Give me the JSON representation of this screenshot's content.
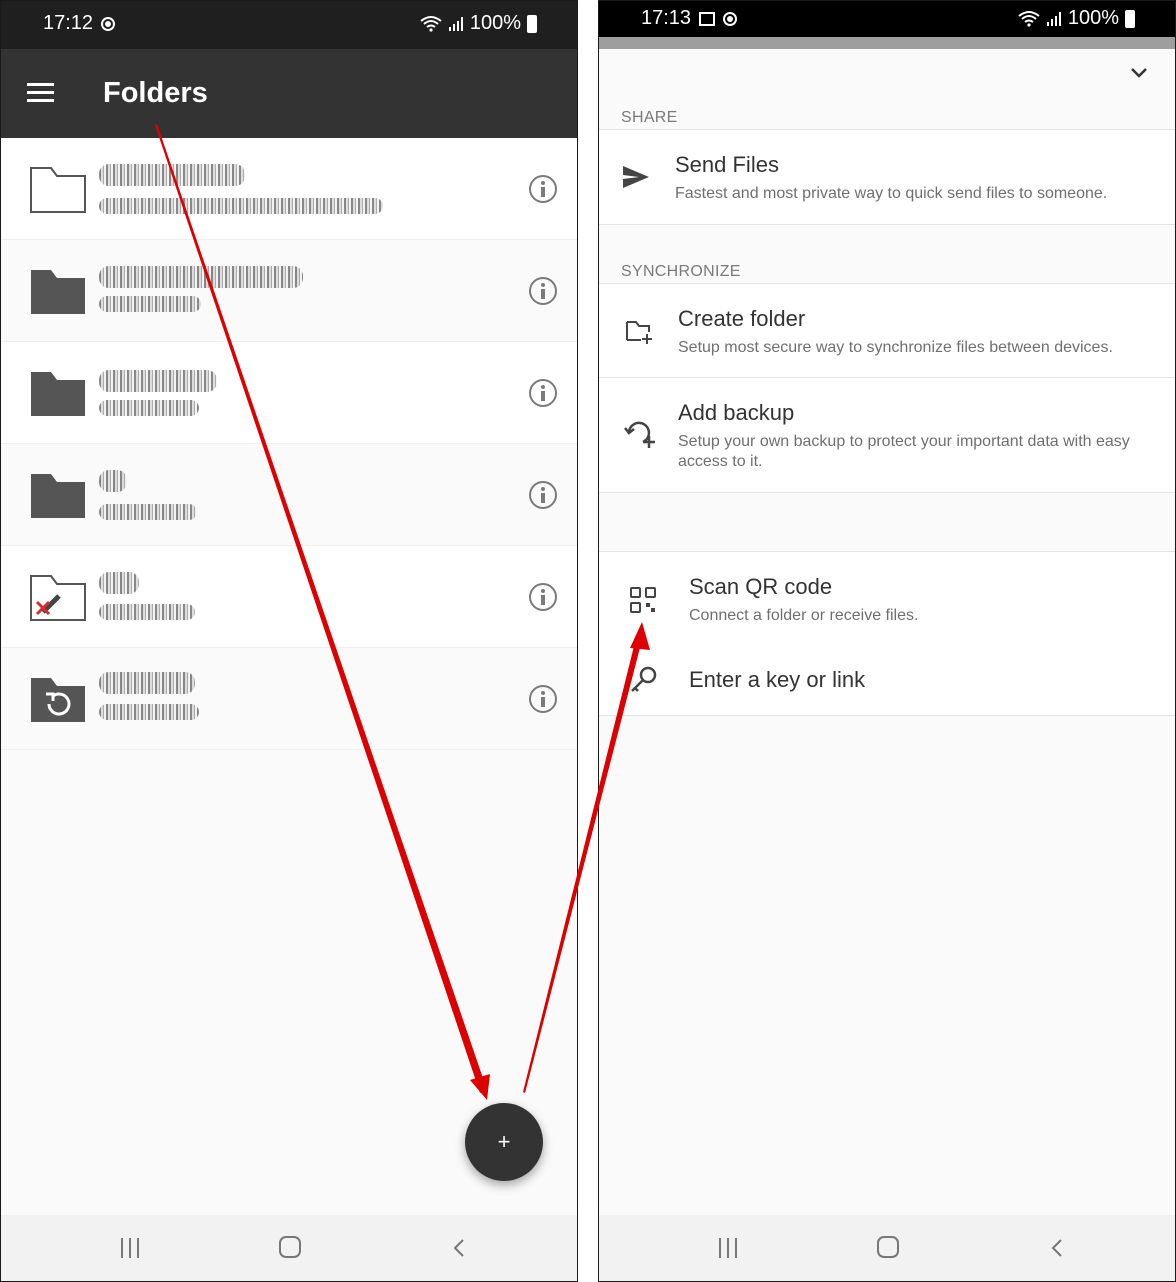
{
  "left": {
    "status": {
      "time": "17:12",
      "battery": "100%"
    },
    "toolbar": {
      "title": "Folders"
    },
    "folders": [
      {
        "icon": "folder-outline-icon"
      },
      {
        "icon": "folder-filled-icon"
      },
      {
        "icon": "folder-filled-icon"
      },
      {
        "icon": "folder-filled-icon"
      },
      {
        "icon": "folder-error-icon"
      },
      {
        "icon": "folder-backup-icon"
      }
    ],
    "fab_label": "+"
  },
  "right": {
    "status": {
      "time": "17:13",
      "battery": "100%"
    },
    "sections": {
      "share": "SHARE",
      "synchronize": "SYNCHRONIZE"
    },
    "items": {
      "send_files": {
        "title": "Send Files",
        "subtitle": "Fastest and most private way to quick send files to someone."
      },
      "create_folder": {
        "title": "Create folder",
        "subtitle": "Setup most secure way to synchronize files between devices."
      },
      "add_backup": {
        "title": "Add backup",
        "subtitle": "Setup your own backup to protect your important data with easy access to it."
      },
      "scan_qr": {
        "title": "Scan QR code",
        "subtitle": "Connect a folder or receive files."
      },
      "enter_key": {
        "title": "Enter a key or link"
      }
    }
  },
  "colors": {
    "toolbar": "#333333",
    "fab": "#333333",
    "annotation_arrow": "#dd0000"
  }
}
